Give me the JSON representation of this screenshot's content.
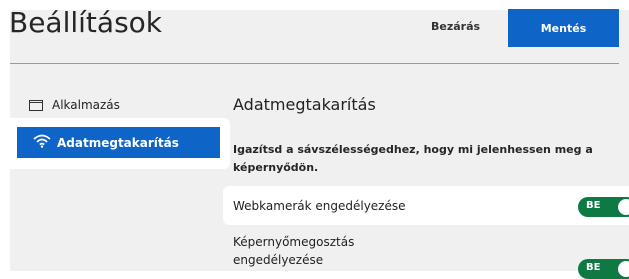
{
  "header": {
    "title": "Beállítások",
    "close_label": "Bezárás",
    "save_label": "Mentés"
  },
  "sidebar": {
    "items": [
      {
        "label": "Alkalmazás",
        "icon": "window-icon"
      },
      {
        "label": "Adatmegtakarítás",
        "icon": "wifi-icon",
        "active": true
      }
    ]
  },
  "main": {
    "section_title": "Adatmegtakarítás",
    "description": "Igazítsd a sávszélességedhez, hogy mi jelenhessen meg a képernyődön.",
    "settings": [
      {
        "label": "Webkamerák engedélyezése",
        "toggle": "BE"
      },
      {
        "label": "Képernyőmegosztás engedélyezése",
        "toggle": "BE"
      }
    ]
  },
  "colors": {
    "accent": "#0f64c8",
    "toggle_on": "#0e7a43",
    "panel_bg": "#f0f0f0"
  }
}
